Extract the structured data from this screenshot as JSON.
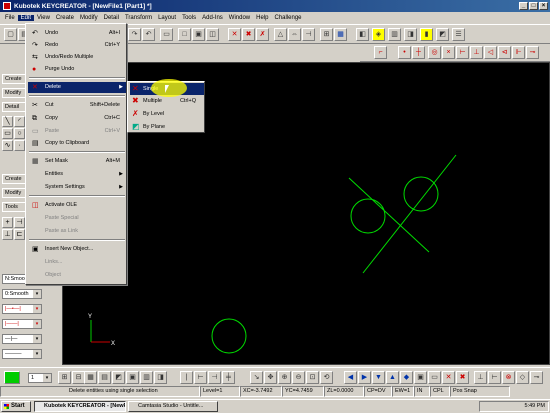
{
  "window": {
    "title": "Kubotek KEYCREATOR - [NewFile1 [Part1] *]"
  },
  "menubar": [
    "File",
    "Edit",
    "View",
    "Create",
    "Modify",
    "Detail",
    "Transform",
    "Layout",
    "Tools",
    "Add-Ins",
    "Window",
    "Help",
    "Challenge"
  ],
  "edit_menu": {
    "items": [
      {
        "label": "Undo",
        "shortcut": "Alt+I",
        "icon": "undo-icon"
      },
      {
        "label": "Redo",
        "shortcut": "Ctrl+Y",
        "icon": "redo-icon"
      },
      {
        "label": "Undo/Redo Multiple",
        "shortcut": "",
        "icon": "undo-multiple-icon"
      },
      {
        "label": "Purge Undo",
        "shortcut": "",
        "icon": "purge-icon"
      },
      {
        "label": "Delete",
        "shortcut": "",
        "icon": "delete-icon"
      },
      {
        "label": "Cut",
        "shortcut": "Shift+Delete",
        "icon": "cut-icon"
      },
      {
        "label": "Copy",
        "shortcut": "Ctrl+C",
        "icon": "copy-icon"
      },
      {
        "label": "Paste",
        "shortcut": "Ctrl+V",
        "icon": "paste-icon"
      },
      {
        "label": "Copy to Clipboard",
        "shortcut": "",
        "icon": "clipboard-icon"
      },
      {
        "label": "Set Mask",
        "shortcut": "Alt+M",
        "icon": "mask-icon"
      },
      {
        "label": "Entities",
        "shortcut": "",
        "icon": ""
      },
      {
        "label": "System Settings",
        "shortcut": "",
        "icon": ""
      },
      {
        "label": "Activate OLE",
        "shortcut": "",
        "icon": "ole-icon"
      },
      {
        "label": "Paste Special",
        "shortcut": "",
        "icon": ""
      },
      {
        "label": "Paste as Link",
        "shortcut": "",
        "icon": ""
      },
      {
        "label": "Insert New Object...",
        "shortcut": "",
        "icon": "insert-object-icon"
      },
      {
        "label": "Links...",
        "shortcut": "",
        "icon": ""
      },
      {
        "label": "Object",
        "shortcut": "",
        "icon": ""
      }
    ]
  },
  "delete_submenu": {
    "items": [
      {
        "label": "Single",
        "shortcut": ""
      },
      {
        "label": "Multiple",
        "shortcut": "Ctrl+Q"
      },
      {
        "label": "By Level",
        "shortcut": ""
      },
      {
        "label": "By Plane",
        "shortcut": ""
      }
    ]
  },
  "left_panel": {
    "tabs_top": [
      "Create",
      "Modify",
      "Detail"
    ],
    "tabs_bottom": [
      "Create",
      "Modify",
      "Tools"
    ],
    "combos": [
      "N:Smooth",
      "0:Smooth"
    ]
  },
  "axes": {
    "x": "X",
    "y": "Y"
  },
  "bottom_bar": {
    "color_level": "1"
  },
  "status": {
    "prompt": "Delete entities using single selection",
    "level": "Level=1",
    "xc": "XC=-3.7492",
    "yc": "YC=4.7459",
    "zl": "ZL=0.0000",
    "cp": "CP=DV",
    "ew": "EW=1",
    "mm": "IN",
    "cpl": "CPL",
    "pos": "Pos Snap"
  },
  "taskbar": {
    "start": "Start",
    "tasks": [
      "Kubotek KEYCREATOR - [NewFile1...",
      "Camtasia Studio - Untitle..."
    ],
    "clock": "5:49 PM"
  },
  "colors": {
    "geometry": "#00dd00",
    "canvas": "#000000",
    "highlight": "#0a246a"
  }
}
